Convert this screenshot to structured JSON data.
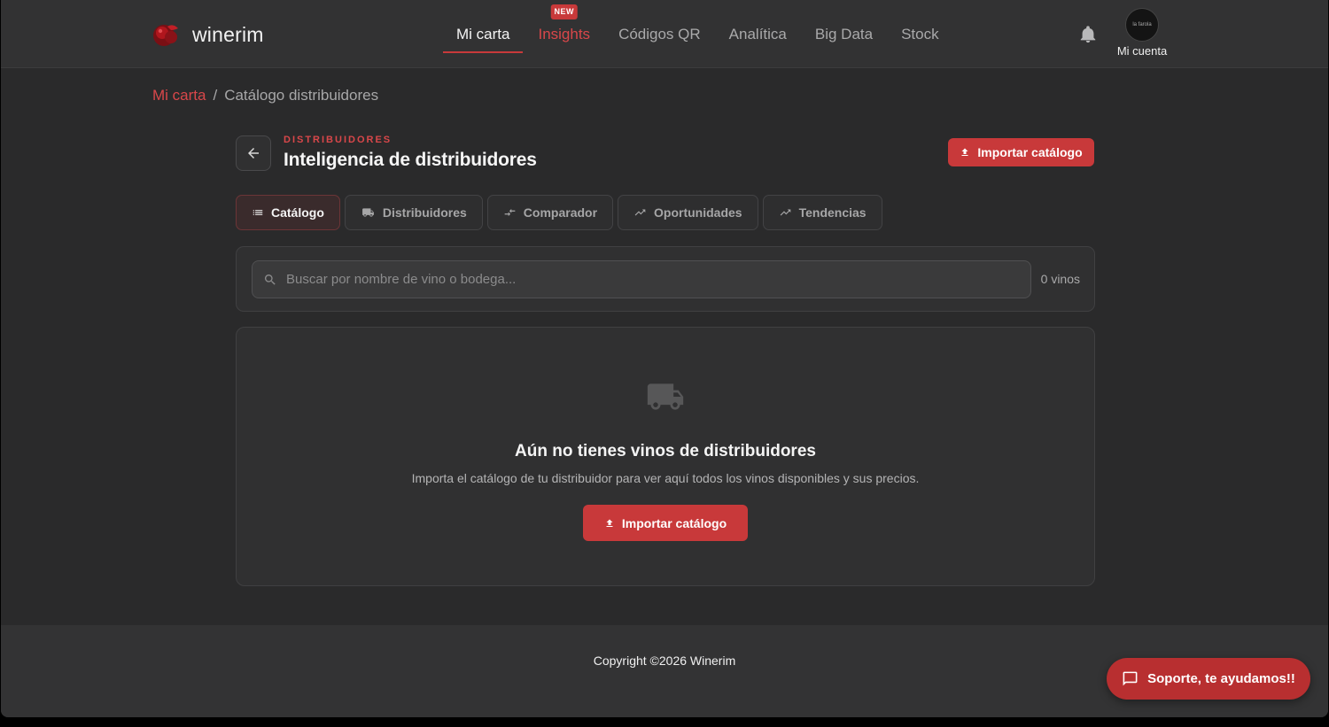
{
  "app": {
    "brand": "winerim"
  },
  "nav": {
    "items": [
      {
        "label": "Mi carta",
        "active": true
      },
      {
        "label": "Insights",
        "badge": "NEW"
      },
      {
        "label": "Códigos QR"
      },
      {
        "label": "Analítica"
      },
      {
        "label": "Big Data"
      },
      {
        "label": "Stock"
      }
    ],
    "account_label": "Mi cuenta",
    "avatar_text": "la farola"
  },
  "breadcrumb": {
    "root": "Mi carta",
    "separator": "/",
    "current": "Catálogo distribuidores"
  },
  "page": {
    "eyebrow": "DISTRIBUIDORES",
    "title": "Inteligencia de distribuidores",
    "import_label": "Importar catálogo"
  },
  "tabs": [
    {
      "label": "Catálogo",
      "icon": "list-icon",
      "active": true
    },
    {
      "label": "Distribuidores",
      "icon": "truck-icon"
    },
    {
      "label": "Comparador",
      "icon": "compare-arrows-icon"
    },
    {
      "label": "Oportunidades",
      "icon": "trending-up-icon"
    },
    {
      "label": "Tendencias",
      "icon": "trending-up-icon"
    }
  ],
  "search": {
    "placeholder": "Buscar por nombre de vino o bodega...",
    "value": "",
    "count": "0 vinos"
  },
  "empty": {
    "title": "Aún no tienes vinos de distribuidores",
    "description": "Importa el catálogo de tu distribuidor para ver aquí todos los vinos disponibles y sus precios.",
    "button": "Importar catálogo"
  },
  "footer": {
    "copyright": "Copyright ©2026 Winerim"
  },
  "support": {
    "label": "Soporte, te ayudamos!!"
  },
  "colors": {
    "accent": "#c8393a",
    "background": "#2a2a2b",
    "header": "#323233"
  }
}
